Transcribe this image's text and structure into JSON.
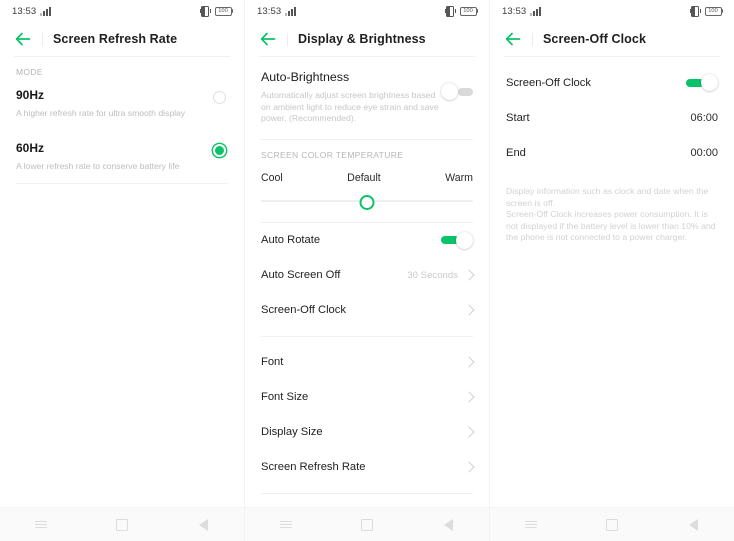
{
  "statusbar": {
    "time": "13:53",
    "signal_icon": "signal-bars-icon",
    "vibrate_icon": "vibrate-mode-icon",
    "battery_level": "100"
  },
  "accent_color": "#0ac268",
  "panels": [
    {
      "id": "screen-refresh-rate",
      "title": "Screen Refresh Rate",
      "back_icon": "back-arrow-icon",
      "section_label": "MODE",
      "options": [
        {
          "title": "90Hz",
          "subtitle": "A higher refresh rate for ultra smooth display",
          "selected": false
        },
        {
          "title": "60Hz",
          "subtitle": "A lower refresh rate to conserve battery life",
          "selected": true
        }
      ]
    },
    {
      "id": "display-and-brightness",
      "title": "Display & Brightness",
      "back_icon": "back-arrow-icon",
      "auto_brightness": {
        "title": "Auto-Brightness",
        "subtitle": "Automatically adjust screen brightness based on ambient light to reduce eye strain and save power. (Recommended).",
        "enabled": false
      },
      "color_temperature": {
        "section_label": "SCREEN COLOR TEMPERATURE",
        "left_label": "Cool",
        "center_label": "Default",
        "right_label": "Warm",
        "value_percent": 50
      },
      "rows_group_one": [
        {
          "label": "Auto Rotate",
          "type": "toggle",
          "enabled": true
        },
        {
          "label": "Auto Screen Off",
          "type": "value",
          "value": "30 Seconds"
        },
        {
          "label": "Screen-Off Clock",
          "type": "link",
          "value": ""
        }
      ],
      "rows_group_two": [
        {
          "label": "Font",
          "type": "link",
          "value": ""
        },
        {
          "label": "Font Size",
          "type": "link",
          "value": ""
        },
        {
          "label": "Display Size",
          "type": "link",
          "value": ""
        },
        {
          "label": "Screen Refresh Rate",
          "type": "link",
          "value": ""
        }
      ]
    },
    {
      "id": "screen-off-clock",
      "title": "Screen-Off Clock",
      "back_icon": "back-arrow-icon",
      "rows": [
        {
          "label": "Screen-Off Clock",
          "type": "toggle",
          "enabled": true
        },
        {
          "label": "Start",
          "type": "value-dark",
          "value": "06:00"
        },
        {
          "label": "End",
          "type": "value-dark",
          "value": "00:00"
        }
      ],
      "description": "Display information such as clock and date when the screen is off.\nScreen-Off Clock increases power consumption. It is not displayed if the battery level is lower than 10% and the phone is not connected to a power charger."
    }
  ],
  "navbar": {
    "menu_icon": "menu-icon",
    "home_icon": "home-square-icon",
    "back_icon": "back-triangle-icon"
  }
}
